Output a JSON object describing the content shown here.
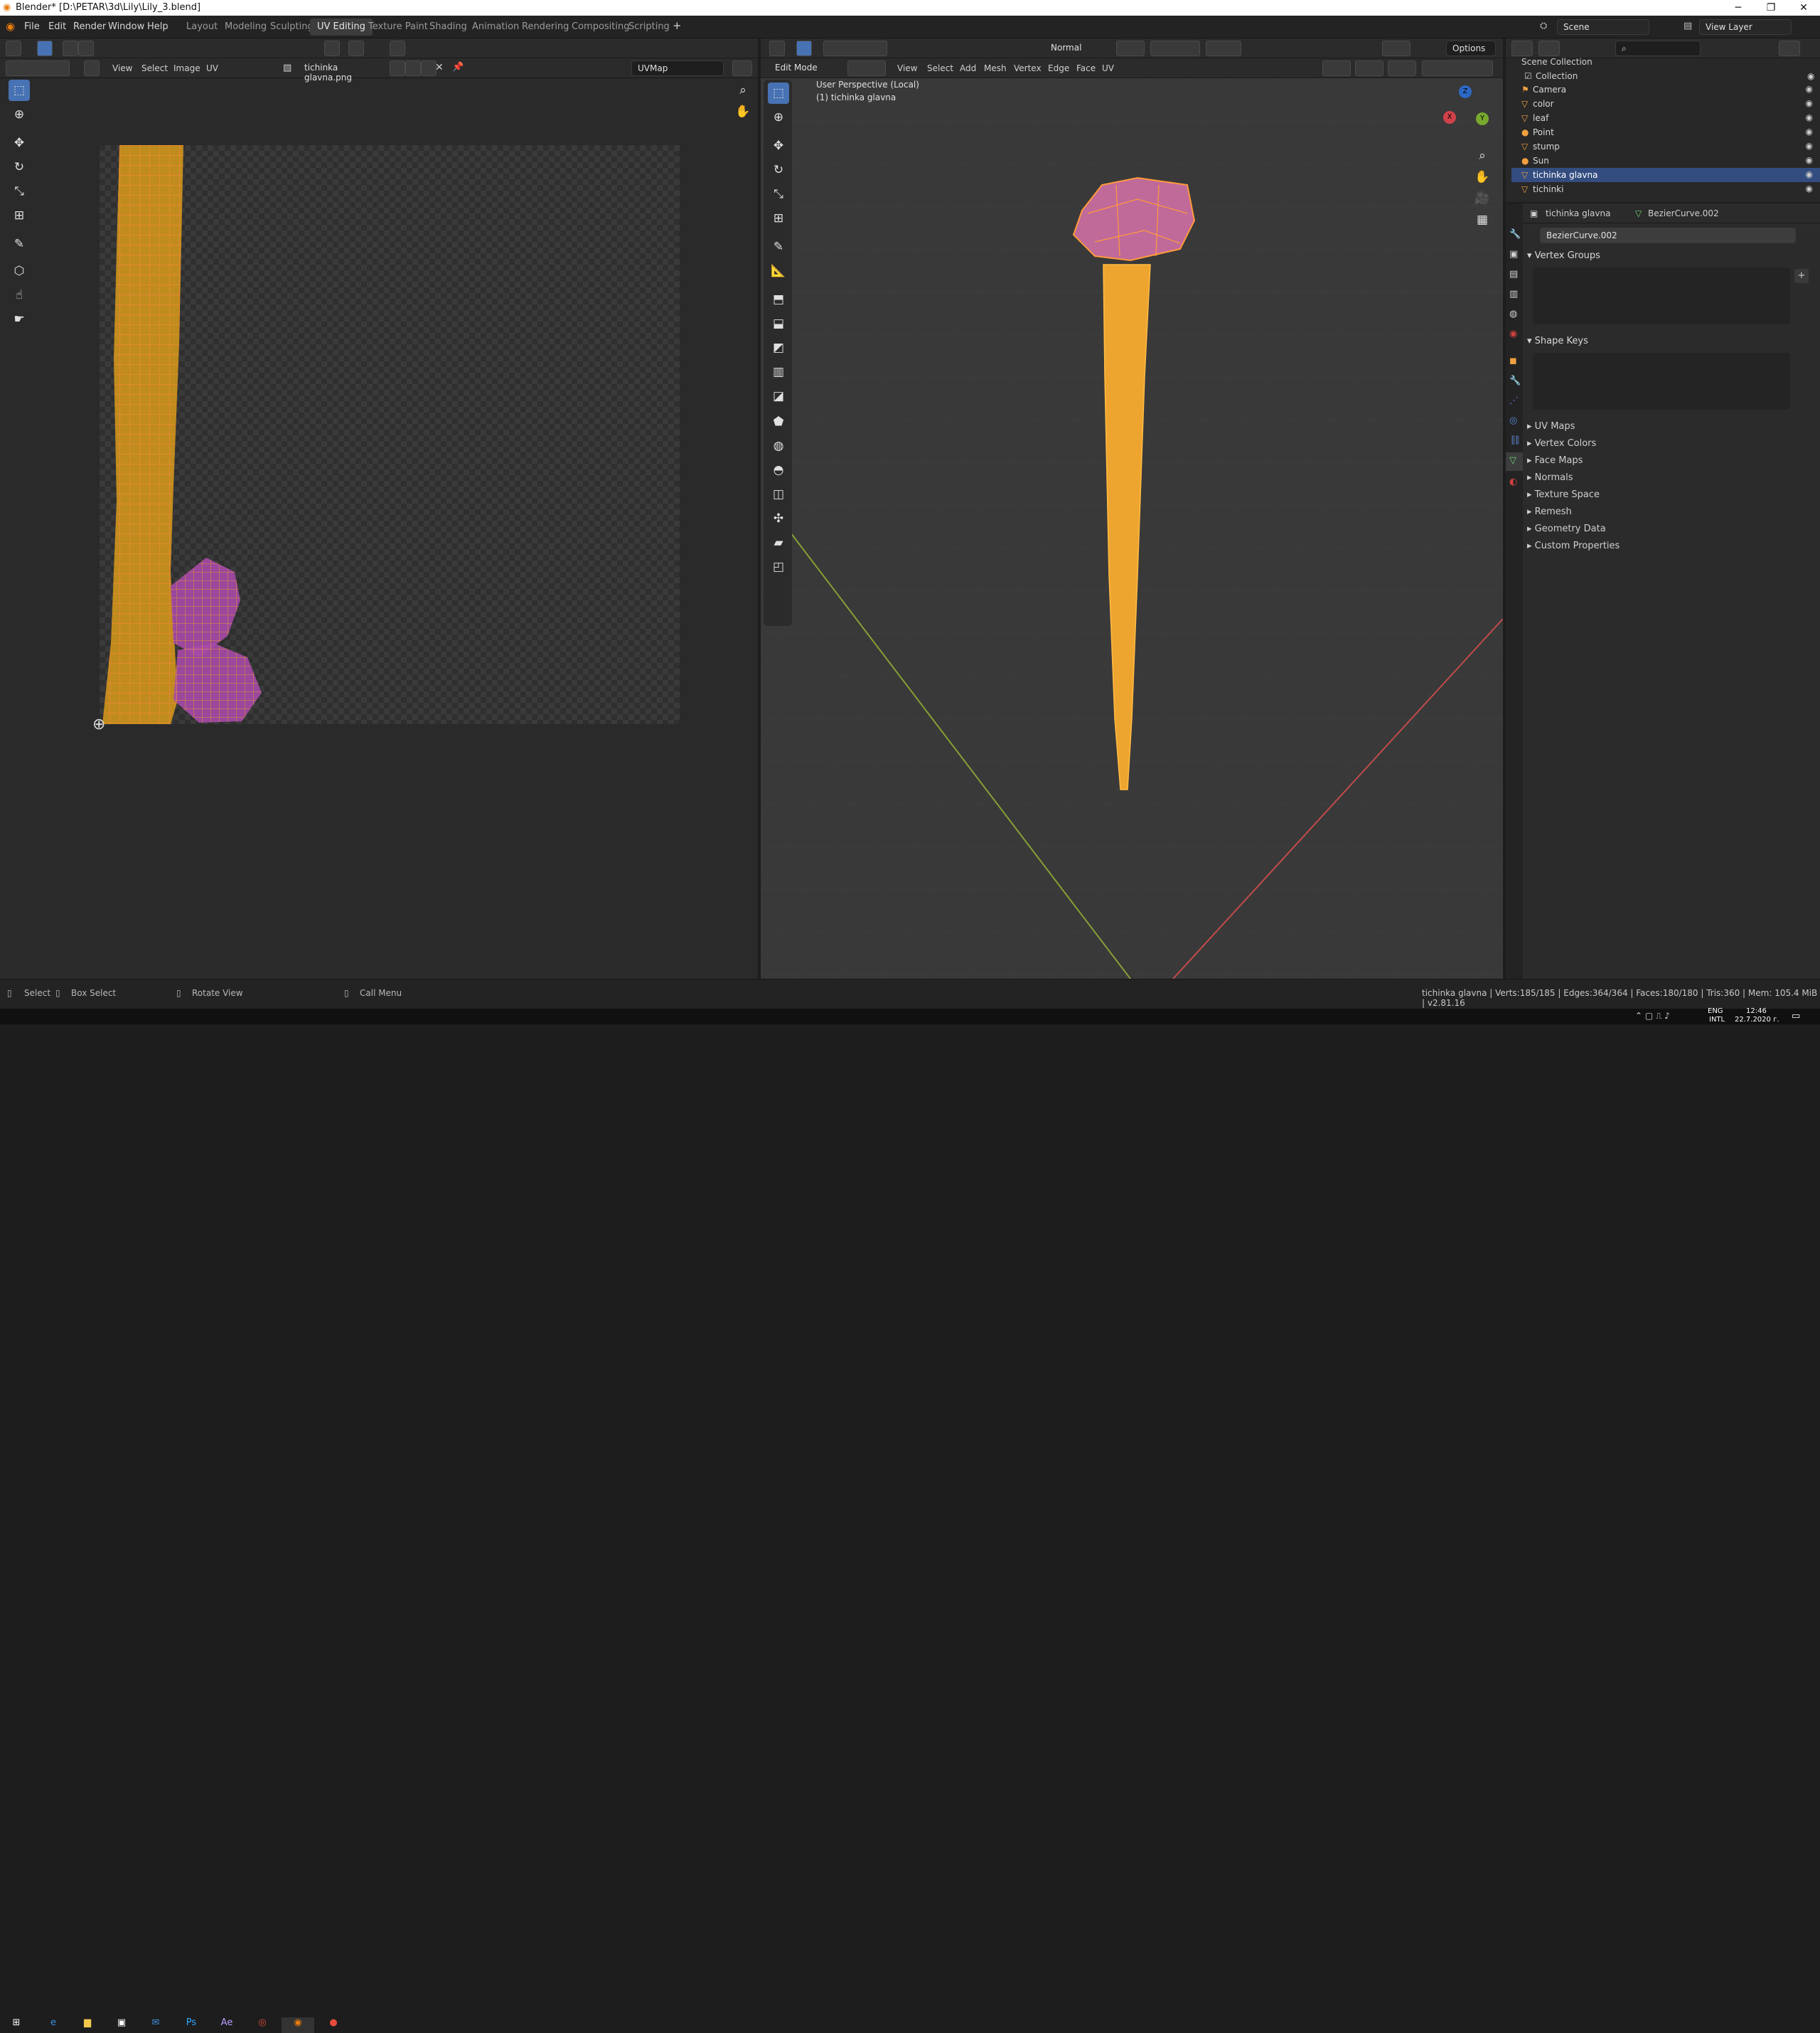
{
  "window": {
    "title": "Blender* [D:\\PETAR\\3d\\Lily\\Lily_3.blend]",
    "minimize": "─",
    "maximize": "❐",
    "close": "✕"
  },
  "menus": [
    "File",
    "Edit",
    "Render",
    "Window",
    "Help"
  ],
  "workspaces": [
    "Layout",
    "Modeling",
    "Sculpting",
    "UV Editing",
    "Texture Paint",
    "Shading",
    "Animation",
    "Rendering",
    "Compositing",
    "Scripting"
  ],
  "active_workspace": "UV Editing",
  "add_workspace": "+",
  "scene": {
    "label": "Scene",
    "view_layer": "View Layer"
  },
  "uv_editor": {
    "menus": [
      "View",
      "Select",
      "Image",
      "UV"
    ],
    "image_name": "tichinka glavna.png",
    "uvmap": "UVMap"
  },
  "viewport": {
    "mode": "Edit Mode",
    "menus": [
      "View",
      "Select",
      "Add",
      "Mesh",
      "Vertex",
      "Edge",
      "Face",
      "UV"
    ],
    "orientation": "Normal",
    "options": "Options",
    "overlay_line1": "User Perspective (Local)",
    "overlay_line2": "(1) tichinka glavna",
    "axis_x": "X",
    "axis_y": "Y",
    "axis_z": "Z"
  },
  "outliner": {
    "search_placeholder": "",
    "scene_collection": "Scene Collection",
    "collection": "Collection",
    "items": [
      {
        "label": "Camera",
        "icon": "camera-icon",
        "selected": false
      },
      {
        "label": "color",
        "icon": "object-icon",
        "selected": false
      },
      {
        "label": "leaf",
        "icon": "object-icon",
        "selected": false
      },
      {
        "label": "Point",
        "icon": "light-icon",
        "selected": false
      },
      {
        "label": "stump",
        "icon": "object-icon",
        "selected": false
      },
      {
        "label": "Sun",
        "icon": "sun-icon",
        "selected": false
      },
      {
        "label": "tichinka glavna",
        "icon": "object-icon",
        "selected": true
      },
      {
        "label": "tichinki",
        "icon": "object-icon",
        "selected": false
      }
    ]
  },
  "properties": {
    "object": "tichinka glavna",
    "mesh": "BezierCurve.002",
    "data_name": "BezierCurve.002",
    "panels_open": [
      "Vertex Groups",
      "Shape Keys"
    ],
    "panels_closed": [
      "UV Maps",
      "Vertex Colors",
      "Face Maps",
      "Normals",
      "Texture Space",
      "Remesh",
      "Geometry Data",
      "Custom Properties"
    ]
  },
  "statusbar": {
    "select": "Select",
    "box_select": "Box Select",
    "rotate_view": "Rotate View",
    "call_menu": "Call Menu",
    "stats": "tichinka glavna | Verts:185/185 | Edges:364/364 | Faces:180/180 | Tris:360 | Mem: 105.4 MiB | v2.81.16"
  },
  "taskbar": {
    "lang": "ENG",
    "lang2": "INTL",
    "time": "12:46",
    "date": "22.7.2020 г."
  },
  "colors": {
    "accent": "#4772b3",
    "mesh_orange": "#e8a42a",
    "flower_pink": "#c86a9a",
    "selection": "#334d80"
  }
}
